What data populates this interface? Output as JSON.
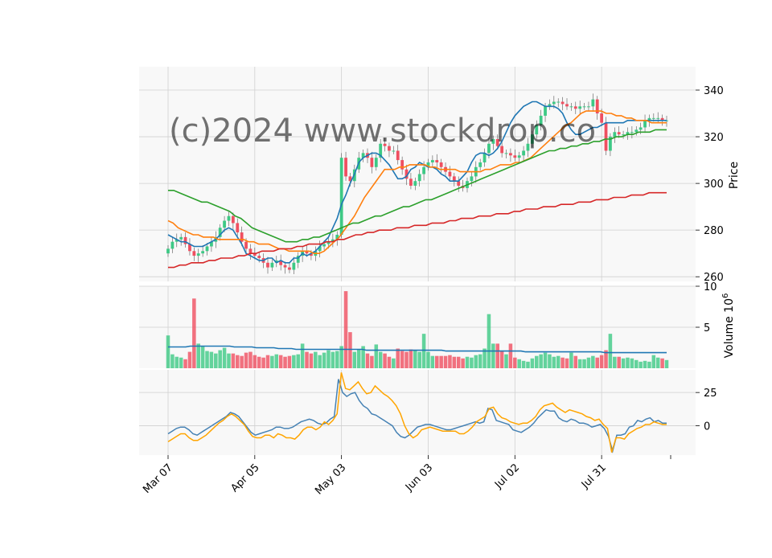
{
  "watermark": "(c)2024 www.stockdrop.co",
  "colors": {
    "up": "#3dc985",
    "down": "#ef4f60",
    "panel_bg": "#f8f8f8",
    "grid": "#d0d0d0",
    "ma5": "#1f77b4",
    "ma20": "#ff7f0e",
    "ma60": "#2ca02c",
    "ma200": "#d62728",
    "vol_avg": "#1f77b4",
    "osc_fast": "#4682b4",
    "osc_slow": "#ffa500"
  },
  "chart_data": [
    {
      "type": "candlestick",
      "panel": "price",
      "ylabel": "Price",
      "ylim": [
        258,
        350
      ],
      "yticks": [
        260,
        280,
        300,
        320,
        340
      ],
      "xtick_labels": [
        "Mar 07",
        "Apr 05",
        "May 03",
        "Jun 03",
        "Jul 02",
        "Jul 31"
      ],
      "xtick_index": [
        0,
        20,
        40,
        60,
        80,
        100
      ],
      "closes": [
        272,
        275,
        276,
        277,
        274,
        271,
        269,
        270,
        271,
        273,
        275,
        277,
        281,
        284,
        286,
        283,
        279,
        275,
        272,
        270,
        269,
        268,
        266,
        264,
        266,
        267,
        265,
        264,
        263,
        266,
        269,
        271,
        270,
        269,
        271,
        273,
        274,
        275,
        276,
        278,
        311,
        303,
        301,
        306,
        311,
        313,
        311,
        307,
        311,
        317,
        316,
        314,
        314,
        310,
        306,
        302,
        299,
        301,
        304,
        307,
        309,
        310,
        309,
        307,
        305,
        303,
        301,
        299,
        298,
        301,
        303,
        307,
        309,
        313,
        317,
        319,
        316,
        313,
        313,
        312,
        311,
        312,
        314,
        317,
        321,
        325,
        329,
        333,
        334,
        335,
        335,
        334,
        333,
        333,
        332,
        333,
        333,
        333,
        336,
        330,
        326,
        314,
        320,
        322,
        321,
        321,
        322,
        322,
        323,
        324,
        327,
        328,
        328,
        328,
        327,
        327
      ],
      "series": [
        {
          "name": "MA5",
          "values": [
            278,
            277,
            276,
            275,
            275,
            274,
            273,
            273,
            273,
            274,
            275,
            276,
            278,
            280,
            281,
            280,
            277,
            274,
            270,
            269,
            268,
            267,
            267,
            268,
            268,
            266,
            267,
            266,
            266,
            268,
            268,
            270,
            269,
            270,
            271,
            273,
            275,
            277,
            281,
            285,
            291,
            295,
            300,
            304,
            309,
            311,
            312,
            313,
            313,
            312,
            310,
            308,
            305,
            302,
            302,
            303,
            306,
            307,
            309,
            308,
            307,
            307,
            306,
            304,
            303,
            301,
            301,
            301,
            303,
            305,
            309,
            312,
            313,
            313,
            312,
            313,
            315,
            318,
            322,
            326,
            329,
            331,
            333,
            334,
            335,
            335,
            334,
            333,
            333,
            333,
            332,
            330,
            326,
            323,
            321,
            321,
            322,
            323,
            324,
            324,
            325,
            326,
            326,
            326,
            326,
            326,
            327,
            327,
            327,
            327,
            327,
            327,
            327,
            327,
            327,
            327
          ],
          "start": 0
        },
        {
          "name": "MA20",
          "values": [
            284,
            283,
            281,
            280,
            279,
            278,
            278,
            277,
            277,
            277,
            276,
            276,
            276,
            276,
            276,
            276,
            275,
            275,
            274,
            274,
            274,
            273,
            272,
            272,
            271,
            271,
            271,
            271,
            271,
            270,
            270,
            271,
            273,
            275,
            277,
            280,
            283,
            286,
            290,
            294,
            297,
            300,
            303,
            306,
            306,
            306,
            307,
            307,
            308,
            308,
            308,
            308,
            307,
            307,
            306,
            306,
            306,
            306,
            305,
            305,
            305,
            305,
            305,
            306,
            306,
            307,
            308,
            308,
            308,
            309,
            309,
            310,
            311,
            313,
            315,
            317,
            319,
            321,
            323,
            325,
            326,
            328,
            330,
            331,
            331,
            331,
            331,
            330,
            330,
            329,
            329,
            328,
            328,
            327,
            327,
            327,
            326,
            326,
            326,
            326
          ],
          "start": 0
        },
        {
          "name": "MA60",
          "values": [
            297,
            297,
            296,
            295,
            294,
            293,
            292,
            292,
            291,
            290,
            289,
            288,
            286,
            285,
            283,
            281,
            280,
            279,
            278,
            277,
            276,
            275,
            275,
            275,
            276,
            276,
            277,
            277,
            278,
            279,
            280,
            281,
            282,
            283,
            283,
            284,
            285,
            286,
            286,
            287,
            288,
            289,
            290,
            290,
            291,
            292,
            293,
            293,
            294,
            295,
            296,
            297,
            298,
            299,
            300,
            301,
            302,
            303,
            304,
            305,
            306,
            307,
            308,
            309,
            310,
            311,
            312,
            313,
            314,
            314,
            315,
            315,
            316,
            316,
            317,
            317,
            318,
            318,
            319,
            319,
            320,
            320,
            321,
            321,
            322,
            322,
            322,
            323,
            323,
            323
          ],
          "start": 0
        },
        {
          "name": "MA200",
          "values": [
            264,
            264,
            265,
            265,
            266,
            266,
            266,
            267,
            267,
            268,
            268,
            268,
            269,
            269,
            270,
            270,
            271,
            271,
            271,
            272,
            272,
            272,
            273,
            273,
            274,
            274,
            274,
            275,
            275,
            276,
            276,
            277,
            278,
            278,
            279,
            279,
            280,
            280,
            280,
            281,
            281,
            281,
            282,
            282,
            282,
            283,
            283,
            283,
            284,
            284,
            285,
            285,
            285,
            286,
            286,
            286,
            287,
            287,
            287,
            288,
            288,
            289,
            289,
            289,
            290,
            290,
            290,
            291,
            291,
            291,
            292,
            292,
            292,
            293,
            293,
            293,
            294,
            294,
            294,
            295,
            295,
            295,
            296,
            296,
            296,
            296
          ],
          "start": 0
        }
      ]
    },
    {
      "type": "bar",
      "panel": "volume",
      "ylabel": "Volume",
      "ylabel_exponent": "10",
      "ylabel_power": "6",
      "ylim": [
        0,
        10
      ],
      "yticks": [
        5,
        10
      ],
      "values": [
        4.0,
        1.7,
        1.4,
        1.3,
        1.1,
        2.0,
        8.5,
        3.0,
        2.7,
        2.1,
        2.0,
        1.8,
        2.2,
        2.5,
        1.8,
        1.8,
        1.6,
        1.5,
        1.9,
        2.0,
        1.6,
        1.4,
        1.3,
        1.6,
        1.5,
        1.7,
        1.6,
        1.4,
        1.5,
        1.6,
        1.7,
        3.0,
        2.0,
        1.8,
        2.0,
        1.6,
        1.9,
        2.2,
        2.0,
        2.1,
        2.7,
        9.4,
        4.4,
        2.0,
        2.3,
        2.7,
        1.8,
        1.5,
        2.9,
        2.0,
        1.8,
        1.4,
        1.2,
        2.4,
        2.1,
        2.0,
        2.3,
        2.2,
        2.0,
        4.2,
        2.0,
        1.5,
        1.5,
        1.5,
        1.5,
        1.6,
        1.4,
        1.4,
        1.2,
        1.4,
        1.3,
        1.6,
        1.7,
        2.4,
        6.6,
        3.0,
        3.0,
        2.1,
        1.7,
        3.0,
        1.3,
        1.1,
        0.9,
        0.8,
        1.2,
        1.5,
        1.7,
        1.9,
        1.7,
        1.4,
        1.5,
        1.3,
        1.2,
        1.9,
        1.5,
        1.1,
        1.1,
        1.3,
        1.5,
        1.3,
        1.6,
        2.2,
        4.2,
        1.4,
        1.4,
        1.2,
        1.3,
        1.2,
        1.0,
        0.8,
        0.9,
        0.8,
        1.6,
        1.3,
        1.2,
        1.0
      ],
      "avg": [
        2.6,
        2.6,
        2.6,
        2.6,
        2.6,
        2.7,
        2.7,
        2.7,
        2.7,
        2.7,
        2.7,
        2.7,
        2.7,
        2.7,
        2.7,
        2.6,
        2.6,
        2.6,
        2.6,
        2.6,
        2.5,
        2.5,
        2.5,
        2.5,
        2.5,
        2.4,
        2.4,
        2.4,
        2.4,
        2.3,
        2.3,
        2.3,
        2.3,
        2.3,
        2.3,
        2.3,
        2.3,
        2.3,
        2.3,
        2.3,
        2.3,
        2.3,
        2.3,
        2.3,
        2.3,
        2.2,
        2.2,
        2.2,
        2.2,
        2.2,
        2.2,
        2.2,
        2.2,
        2.2,
        2.2,
        2.2,
        2.2,
        2.2,
        2.2,
        2.2,
        2.2,
        2.2,
        2.2,
        2.1,
        2.1,
        2.1,
        2.1,
        2.1,
        2.1,
        2.1,
        2.1,
        2.1,
        2.1,
        2.1,
        2.1,
        2.1,
        2.1,
        2.1,
        2.1,
        2.1,
        2.1,
        2.0,
        2.0,
        2.0,
        2.0,
        2.0,
        2.0,
        2.0,
        2.0,
        2.0,
        2.0,
        2.0,
        2.0,
        2.0,
        2.0,
        2.0,
        2.0,
        2.0,
        2.0,
        1.9,
        1.9,
        1.9,
        1.9,
        1.9,
        1.9,
        1.9,
        1.9,
        1.9,
        1.9,
        1.9,
        1.9,
        1.9,
        1.9,
        1.9
      ]
    },
    {
      "type": "line",
      "panel": "oscillator",
      "ylim": [
        -22,
        42
      ],
      "yticks": [
        0,
        25
      ],
      "series": [
        {
          "name": "",
          "values": [
            -6,
            -4,
            -2,
            -1,
            -1,
            -3,
            -6,
            -7,
            -5,
            -3,
            -1,
            1,
            3,
            5,
            7,
            10,
            9,
            7,
            3,
            -1,
            -5,
            -7,
            -6,
            -5,
            -4,
            -3,
            -1,
            -1,
            -2,
            -2,
            -1,
            1,
            3,
            4,
            5,
            4,
            2,
            1,
            2,
            5,
            7,
            35,
            25,
            22,
            24,
            25,
            19,
            15,
            13,
            9,
            8,
            6,
            4,
            2,
            0,
            -5,
            -8,
            -9,
            -7,
            -4,
            -1,
            0,
            1,
            1,
            0,
            -1,
            -2,
            -3,
            -3,
            -2,
            -1,
            0,
            1,
            2,
            3,
            2,
            3,
            13,
            12,
            4,
            3,
            2,
            1,
            -3,
            -4,
            -5,
            -3,
            -1,
            2,
            6,
            9,
            12,
            11,
            11,
            6,
            4,
            3,
            5,
            4,
            2,
            2,
            1,
            -1,
            0,
            1,
            -2,
            -8,
            -19,
            -7,
            -7,
            -6,
            -1,
            0,
            4,
            3,
            5,
            6,
            3,
            4,
            2,
            2
          ],
          "start": 0
        },
        {
          "name": "",
          "values": [
            -12,
            -10,
            -8,
            -6,
            -6,
            -9,
            -11,
            -11,
            -9,
            -7,
            -4,
            -1,
            2,
            4,
            7,
            9,
            7,
            4,
            1,
            -4,
            -8,
            -9,
            -9,
            -7,
            -7,
            -9,
            -6,
            -7,
            -9,
            -9,
            -10,
            -7,
            -3,
            -1,
            -1,
            -3,
            -1,
            3,
            1,
            4,
            9,
            40,
            28,
            27,
            30,
            33,
            28,
            24,
            25,
            30,
            27,
            24,
            22,
            19,
            15,
            9,
            0,
            -6,
            -9,
            -7,
            -3,
            -2,
            -1,
            -2,
            -3,
            -4,
            -4,
            -4,
            -4,
            -6,
            -6,
            -4,
            -1,
            3,
            5,
            7,
            13,
            14,
            9,
            6,
            5,
            3,
            2,
            1,
            2,
            2,
            4,
            7,
            12,
            15,
            16,
            17,
            14,
            12,
            10,
            12,
            11,
            10,
            9,
            7,
            6,
            4,
            5,
            1,
            -2,
            -20,
            -9,
            -9,
            -10,
            -6,
            -4,
            -2,
            -1,
            1,
            1,
            3,
            2,
            1,
            1
          ],
          "start": 0
        }
      ]
    }
  ]
}
